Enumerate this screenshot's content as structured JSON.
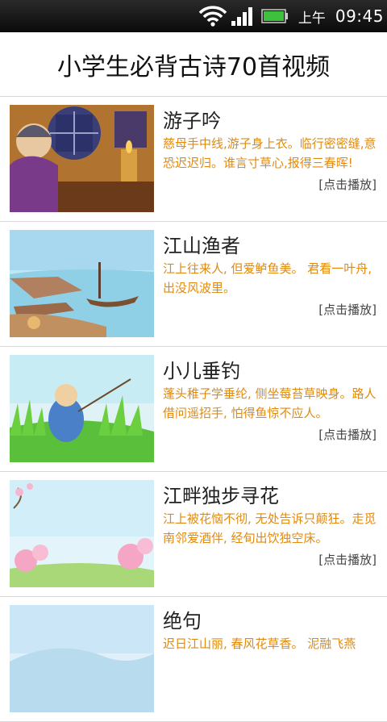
{
  "status_bar": {
    "ampm": "上午",
    "time": "09:45",
    "icons": [
      "wifi-icon",
      "signal-icon",
      "battery-icon"
    ],
    "battery_color": "#3ec23e"
  },
  "header": {
    "title": "小学生必背古诗70首视频"
  },
  "poems": [
    {
      "title": "游子吟",
      "desc": "慈母手中线,游子身上衣。临行密密缝,意恐迟迟归。谁言寸草心,报得三春晖!",
      "play": "[点击播放]"
    },
    {
      "title": "江山渔者",
      "desc": "江上往来人, 但爱鲈鱼美。 君看一叶舟, 出没风波里。",
      "play": "[点击播放]"
    },
    {
      "title": "小儿垂钓",
      "desc": "蓬头稚子学垂纶, 侧坐莓苔草映身。路人借问遥招手, 怕得鱼惊不应人。",
      "play": "[点击播放]"
    },
    {
      "title": "江畔独步寻花",
      "desc": "江上被花恼不彻, 无处告诉只颠狂。走觅南邻爱酒伴, 经旬出饮独空床。",
      "play": "[点击播放]"
    },
    {
      "title": "绝句",
      "desc": "迟日江山丽, 春风花草香。 泥融飞燕",
      "play": ""
    }
  ],
  "colors": {
    "desc_text": "#e08a10",
    "divider": "#d8d8d8"
  }
}
